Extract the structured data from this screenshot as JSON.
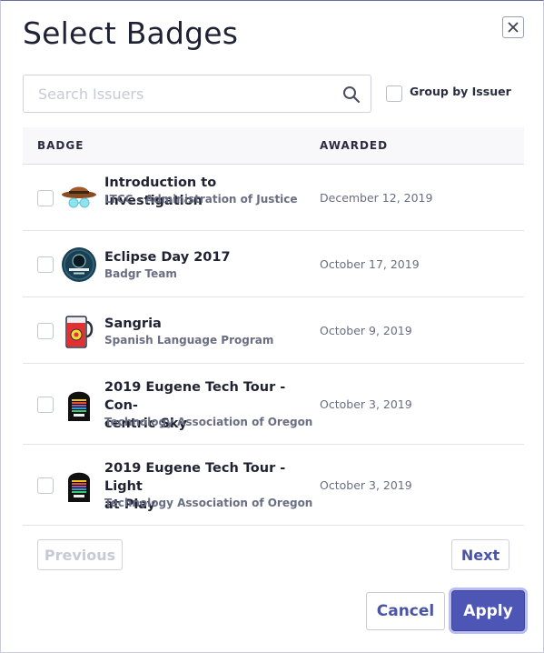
{
  "dialog": {
    "title": "Select Badges",
    "close_icon": "close-icon"
  },
  "search": {
    "placeholder": "Search Issuers",
    "value": "",
    "icon": "search-icon"
  },
  "group_by_issuer": {
    "label": "Group by Issuer",
    "checked": false
  },
  "table": {
    "headers": {
      "badge": "BADGE",
      "awarded": "AWARDED"
    },
    "rows": [
      {
        "name": "Introduction to Investigation",
        "issuer": "LTCC - Administration of Justice",
        "awarded": "December 12, 2019",
        "icon": "detective-hat-icon",
        "checked": false
      },
      {
        "name": "Eclipse Day 2017",
        "issuer": "Badgr Team",
        "awarded": "October 17, 2019",
        "icon": "eclipse-badge-icon",
        "checked": false
      },
      {
        "name": "Sangria",
        "issuer": "Spanish Language Program",
        "awarded": "October 9, 2019",
        "icon": "pitcher-icon",
        "checked": false
      },
      {
        "name": "2019 Eugene Tech Tour - Con-centric Sky",
        "name_line1": "2019 Eugene Tech Tour - Con-",
        "name_line2": "centric Sky",
        "issuer": "Technology Association of Oregon",
        "awarded": "October 3, 2019",
        "icon": "tech-tour-badge-icon",
        "checked": false
      },
      {
        "name": "2019 Eugene Tech Tour - Light at Play",
        "name_line1": "2019 Eugene Tech Tour - Light",
        "name_line2": "at Play",
        "issuer": "Technology Association of Oregon",
        "awarded": "October 3, 2019",
        "icon": "tech-tour-badge-icon",
        "checked": false
      }
    ]
  },
  "pagination": {
    "previous_label": "Previous",
    "next_label": "Next",
    "previous_enabled": false
  },
  "actions": {
    "cancel_label": "Cancel",
    "apply_label": "Apply"
  },
  "colors": {
    "accent": "#4d56b5",
    "text": "#1f2233",
    "muted": "#6a6e82"
  }
}
